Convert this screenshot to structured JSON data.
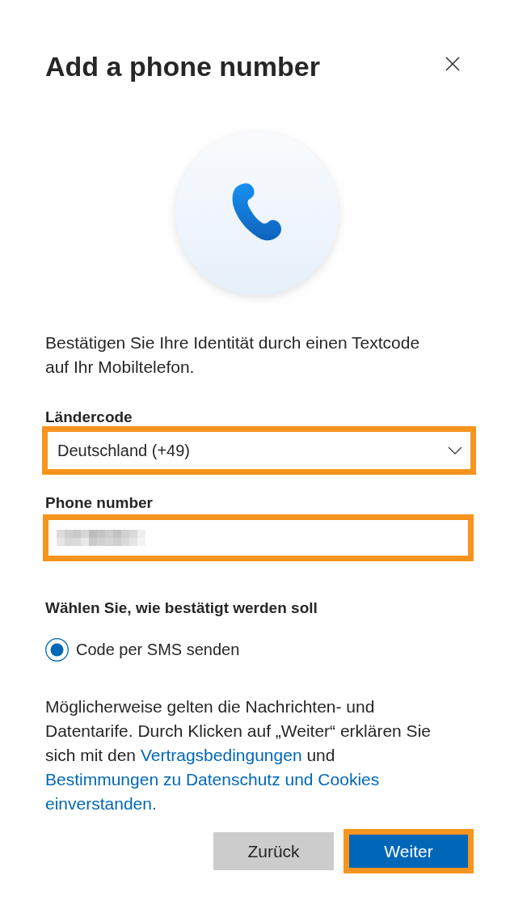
{
  "dialog": {
    "title": "Add a phone number"
  },
  "intro": "Bestätigen Sie Ihre Identität durch einen Textcode auf Ihr Mobiltelefon.",
  "country_code": {
    "label": "Ländercode",
    "value": "Deutschland (+49)",
    "highlighted": true
  },
  "phone_number": {
    "label": "Phone number",
    "value_redacted": true,
    "highlighted": true
  },
  "verification": {
    "label": "Wählen Sie, wie bestätigt werden soll",
    "options": [
      {
        "label": "Code per SMS senden",
        "selected": true
      }
    ]
  },
  "notice": {
    "parts": [
      {
        "kind": "text",
        "text": "Möglicherweise gelten die Nachrichten- und Datentarife. Durch Klicken auf „Weiter“ erklären Sie sich mit den "
      },
      {
        "kind": "link",
        "text": "Vertragsbedingungen"
      },
      {
        "kind": "text",
        "text": " und "
      },
      {
        "kind": "link",
        "text": "Bestimmungen zu Datenschutz und Cookies"
      },
      {
        "kind": "link",
        "text": "einverstanden."
      }
    ]
  },
  "buttons": [
    {
      "label": "Zurück",
      "kind": "secondary",
      "highlighted": false
    },
    {
      "label": "Weiter",
      "kind": "primary",
      "highlighted": true
    }
  ]
}
